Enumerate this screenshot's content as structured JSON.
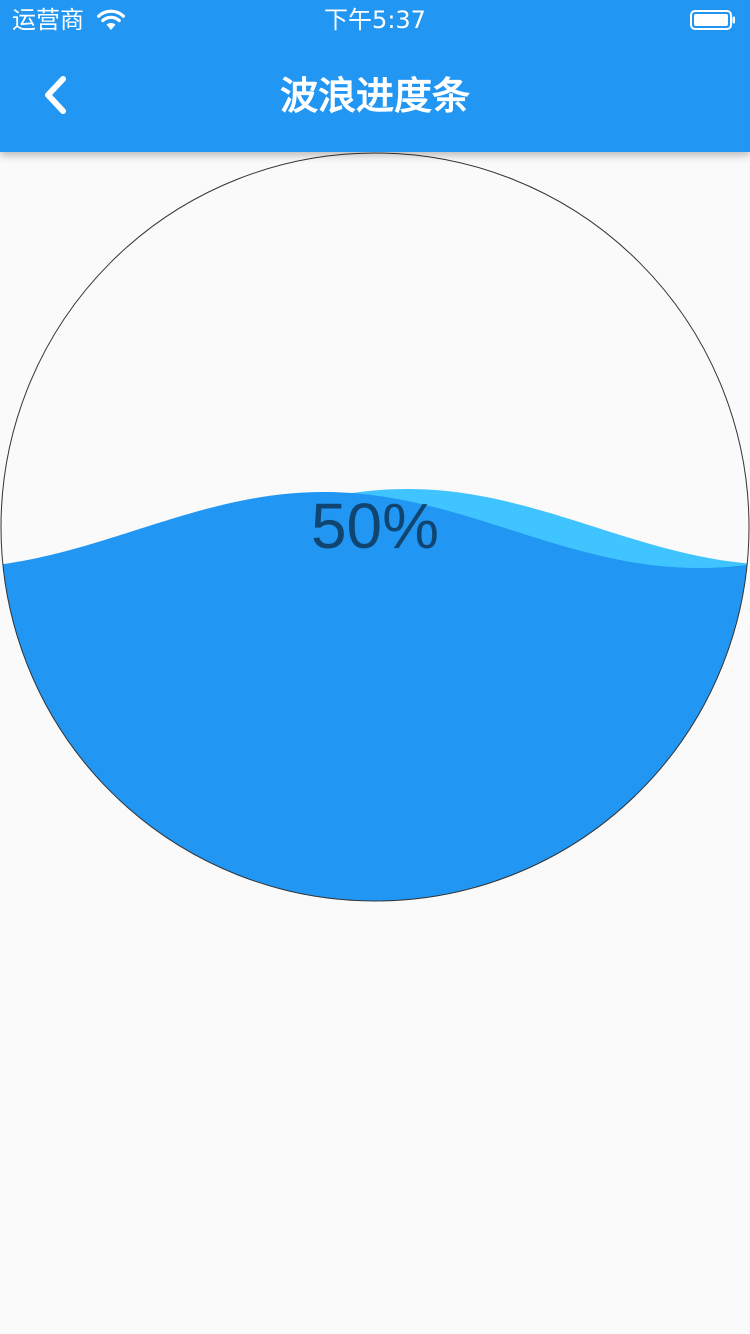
{
  "status_bar": {
    "carrier": "运营商",
    "time": "下午5:37"
  },
  "nav": {
    "title": "波浪进度条"
  },
  "progress": {
    "value": 0.5,
    "label": "50%"
  },
  "colors": {
    "primary": "#2196f3",
    "wave_back": "#40c4ff",
    "background": "#fafafa",
    "label": "rgba(0,0,0,0.54)"
  },
  "icons": {
    "back": "chevron-left-icon",
    "wifi": "wifi-icon",
    "battery": "battery-icon"
  }
}
